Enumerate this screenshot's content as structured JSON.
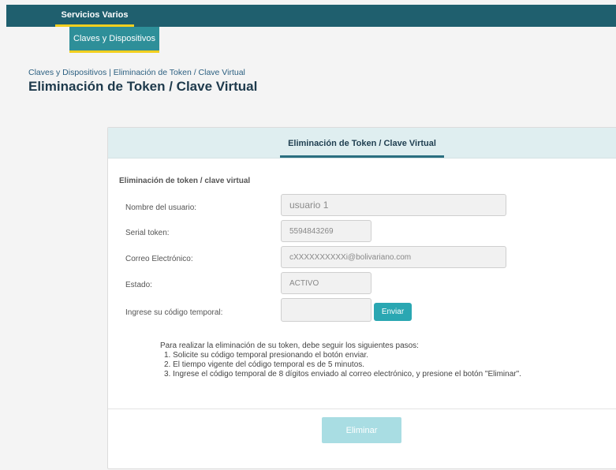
{
  "topnav": {
    "servicios_label": "Servicios Varios"
  },
  "subnav": {
    "claves_label": "Claves y Dispositivos"
  },
  "breadcrumb": "Claves y Dispositivos | Eliminación de Token / Clave Virtual",
  "page_title": "Eliminación de Token / Clave Virtual",
  "card": {
    "tab_label": "Eliminación de Token / Clave Virtual",
    "section_title": "Eliminación de token / clave virtual",
    "fields": {
      "username": {
        "label": "Nombre del usuario:",
        "value": "usuario 1"
      },
      "serial": {
        "label": "Serial token:",
        "value": "5594843269"
      },
      "email": {
        "label": "Correo Electrónico:",
        "value": "cXXXXXXXXXXi@bolivariano.com"
      },
      "status": {
        "label": "Estado:",
        "value": "ACTIVO"
      },
      "code": {
        "label": "Ingrese su código temporal:",
        "value": ""
      }
    },
    "send_label": "Enviar",
    "instructions": {
      "intro": "Para realizar la eliminación de su token, debe seguir los siguientes pasos:",
      "steps": [
        "1. Solicite su código temporal presionando el botón enviar.",
        "2. El tiempo vigente del código temporal es de 5 minutos.",
        "3. Ingrese el código temporal de 8 dígitos enviado al correo electrónico, y presione el botón \"Eliminar\"."
      ]
    },
    "delete_label": "Eliminar"
  },
  "colors": {
    "topbar": "#1f5f6e",
    "accent_yellow": "#f2cf1f",
    "subnav": "#2e8f99",
    "send_button": "#2aa7b2",
    "delete_button_disabled": "#a9dde3"
  }
}
